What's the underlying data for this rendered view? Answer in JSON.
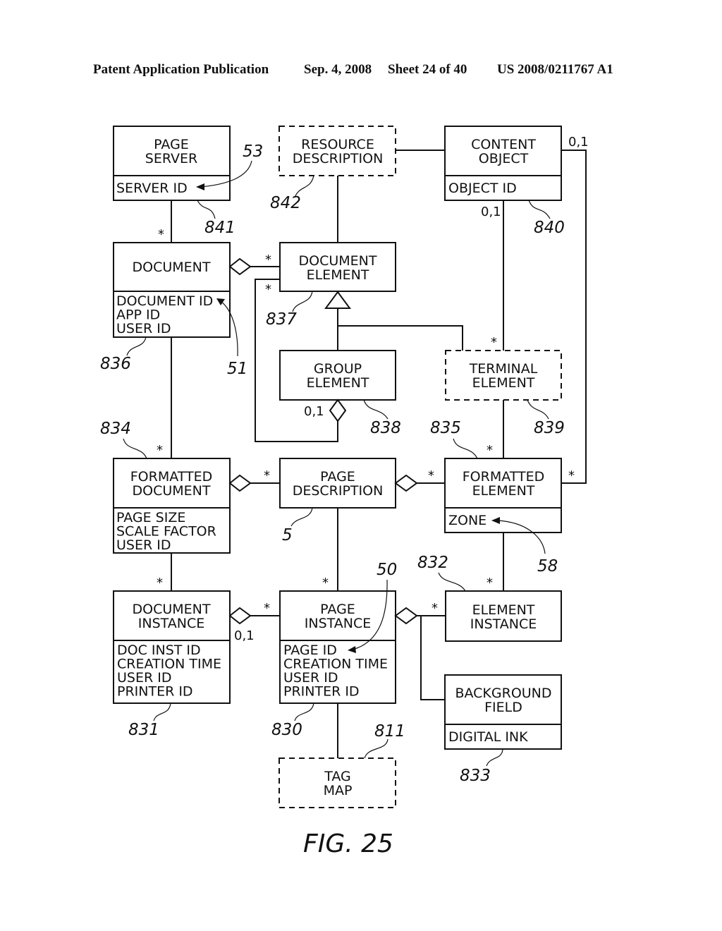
{
  "header": {
    "publication": "Patent Application Publication",
    "date": "Sep. 4, 2008",
    "sheet": "Sheet 24 of 40",
    "number": "US 2008/0211767 A1"
  },
  "figure_label": "FIG. 25",
  "classes": {
    "page_server": {
      "title": [
        "PAGE",
        "SERVER"
      ],
      "attributes": [
        "SERVER ID"
      ],
      "ref": "841",
      "style": "solid"
    },
    "resource_description": {
      "title": [
        "RESOURCE",
        "DESCRIPTION"
      ],
      "attributes": [],
      "ref": "842",
      "style": "dashed"
    },
    "content_object": {
      "title": [
        "CONTENT",
        "OBJECT"
      ],
      "attributes": [
        "OBJECT ID"
      ],
      "ref": "840",
      "style": "solid"
    },
    "document": {
      "title": [
        "DOCUMENT"
      ],
      "attributes": [
        "DOCUMENT ID",
        "APP ID",
        "USER ID"
      ],
      "ref": "836",
      "style": "solid"
    },
    "document_element": {
      "title": [
        "DOCUMENT",
        "ELEMENT"
      ],
      "attributes": [],
      "ref": "837",
      "style": "solid"
    },
    "group_element": {
      "title": [
        "GROUP",
        "ELEMENT"
      ],
      "attributes": [],
      "ref": "838",
      "style": "solid"
    },
    "terminal_element": {
      "title": [
        "TERMINAL",
        "ELEMENT"
      ],
      "attributes": [],
      "ref": "839",
      "style": "dashed"
    },
    "formatted_document": {
      "title": [
        "FORMATTED",
        "DOCUMENT"
      ],
      "attributes": [
        "PAGE SIZE",
        "SCALE FACTOR",
        "USER ID"
      ],
      "ref": "834",
      "style": "solid"
    },
    "page_description": {
      "title": [
        "PAGE",
        "DESCRIPTION"
      ],
      "attributes": [],
      "ref": "5",
      "style": "solid"
    },
    "formatted_element": {
      "title": [
        "FORMATTED",
        "ELEMENT"
      ],
      "attributes": [
        "ZONE"
      ],
      "ref": "835",
      "style": "solid"
    },
    "document_instance": {
      "title": [
        "DOCUMENT",
        "INSTANCE"
      ],
      "attributes": [
        "DOC INST ID",
        "CREATION TIME",
        "USER ID",
        "PRINTER ID"
      ],
      "ref": "831",
      "style": "solid"
    },
    "page_instance": {
      "title": [
        "PAGE",
        "INSTANCE"
      ],
      "attributes": [
        "PAGE ID",
        "CREATION TIME",
        "USER ID",
        "PRINTER ID"
      ],
      "ref": "830",
      "style": "solid"
    },
    "element_instance": {
      "title": [
        "ELEMENT",
        "INSTANCE"
      ],
      "attributes": [],
      "ref": "832",
      "style": "solid"
    },
    "background_field": {
      "title": [
        "BACKGROUND",
        "FIELD"
      ],
      "attributes": [
        "DIGITAL INK"
      ],
      "ref": "833",
      "style": "solid"
    },
    "tag_map": {
      "title": [
        "TAG",
        "MAP"
      ],
      "attributes": [],
      "ref": "811",
      "style": "dashed"
    }
  },
  "pointer_refs": {
    "server_id": "53",
    "document_id": "51",
    "zone": "58",
    "page_id": "50"
  },
  "multiplicities": {
    "many": "*",
    "zero_or_one": "0,1"
  },
  "relationships": [
    {
      "from": "page_server",
      "to": "document",
      "type": "association",
      "to_mult": "*"
    },
    {
      "from": "resource_description",
      "to": "content_object",
      "type": "association"
    },
    {
      "from": "resource_description",
      "to": "document_element",
      "type": "association"
    },
    {
      "from": "document",
      "to": "document_element",
      "type": "aggregation",
      "to_mult": "*"
    },
    {
      "from": "group_element",
      "to": "document_element",
      "type": "aggregation",
      "from_mult": "0,1",
      "to_mult": "*"
    },
    {
      "from": "group_element",
      "to": "document_element",
      "type": "generalization"
    },
    {
      "from": "terminal_element",
      "to": "document_element",
      "type": "generalization"
    },
    {
      "from": "content_object",
      "to": "terminal_element",
      "type": "association",
      "from_mult": "0,1",
      "to_mult": "*"
    },
    {
      "from": "content_object",
      "to": "formatted_element",
      "type": "association",
      "from_mult": "0,1",
      "to_mult": "*"
    },
    {
      "from": "document",
      "to": "formatted_document",
      "type": "association",
      "to_mult": "*"
    },
    {
      "from": "terminal_element",
      "to": "formatted_element",
      "type": "association",
      "to_mult": "*"
    },
    {
      "from": "formatted_document",
      "to": "page_description",
      "type": "aggregation",
      "to_mult": "*"
    },
    {
      "from": "page_description",
      "to": "formatted_element",
      "type": "aggregation",
      "to_mult": "*"
    },
    {
      "from": "formatted_document",
      "to": "document_instance",
      "type": "association",
      "to_mult": "*"
    },
    {
      "from": "page_description",
      "to": "page_instance",
      "type": "association",
      "to_mult": "*"
    },
    {
      "from": "formatted_element",
      "to": "element_instance",
      "type": "association",
      "to_mult": "*"
    },
    {
      "from": "document_instance",
      "to": "page_instance",
      "type": "aggregation",
      "from_mult": "0,1",
      "to_mult": "*"
    },
    {
      "from": "page_instance",
      "to": "element_instance",
      "type": "aggregation",
      "to_mult": "*"
    },
    {
      "from": "page_instance",
      "to": "background_field",
      "type": "aggregation"
    },
    {
      "from": "page_instance",
      "to": "tag_map",
      "type": "association"
    }
  ]
}
